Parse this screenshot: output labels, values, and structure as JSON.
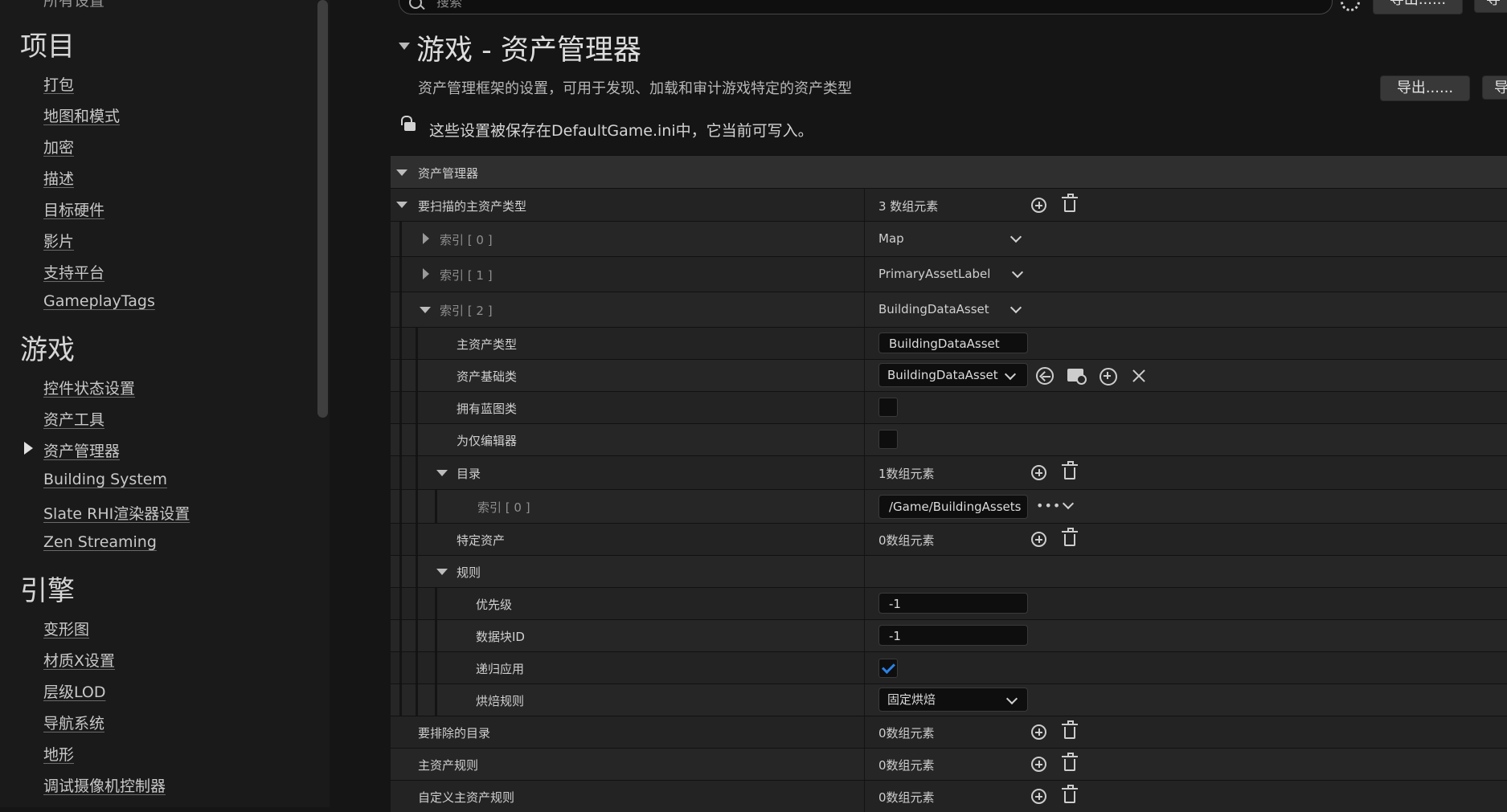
{
  "sidebar": {
    "cut_item": "所有设置",
    "sections": [
      {
        "title": "项目",
        "items": [
          "打包",
          "地图和模式",
          "加密",
          "描述",
          "目标硬件",
          "影片",
          "支持平台",
          "GameplayTags"
        ]
      },
      {
        "title": "游戏",
        "items": [
          "控件状态设置",
          "资产工具",
          "资产管理器",
          "Building System",
          "Slate RHI渲染器设置",
          "Zen Streaming"
        ]
      },
      {
        "title": "引擎",
        "items": [
          "变形图",
          "材质X设置",
          "层级LOD",
          "导航系统",
          "地形",
          "调试摄像机控制器"
        ]
      }
    ],
    "active_item": "资产管理器"
  },
  "toolbar": {
    "search_placeholder": "搜索",
    "export_top_label": "导出......",
    "export_label": "导出......",
    "import_partial_label": "导"
  },
  "header": {
    "title": "游戏 - 资产管理器",
    "description": "资产管理框架的设置，可用于发现、加载和审计游戏特定的资产类型",
    "save_note": "这些设置被保存在DefaultGame.ini中，它当前可写入。"
  },
  "grid": {
    "category": "资产管理器",
    "primary_types": {
      "label": "要扫描的主资产类型",
      "value": "3 数组元素"
    },
    "index0": {
      "label": "索引 [ 0 ]",
      "value": "Map"
    },
    "index1": {
      "label": "索引 [ 1 ]",
      "value": "PrimaryAssetLabel"
    },
    "index2": {
      "label": "索引 [ 2 ]",
      "value": "BuildingDataAsset"
    },
    "primary_asset_type": {
      "label": "主资产类型",
      "value": "BuildingDataAsset"
    },
    "asset_base_class": {
      "label": "资产基础类",
      "value": "BuildingDataAsset"
    },
    "has_blueprint": {
      "label": "拥有蓝图类",
      "checked": false
    },
    "editor_only": {
      "label": "为仅编辑器",
      "checked": false
    },
    "directories": {
      "label": "目录",
      "value": "1数组元素"
    },
    "dir_index0": {
      "label": "索引 [ 0 ]",
      "value": "/Game/BuildingAssets"
    },
    "specific_assets": {
      "label": "特定资产",
      "value": "0数组元素"
    },
    "rules": {
      "label": "规则"
    },
    "priority": {
      "label": "优先级",
      "value": "-1"
    },
    "chunk_id": {
      "label": "数据块ID",
      "value": "-1"
    },
    "apply_recursively": {
      "label": "递归应用",
      "checked": true
    },
    "cook_rule": {
      "label": "烘焙规则",
      "value": "固定烘焙"
    },
    "excluded_dirs": {
      "label": "要排除的目录",
      "value": "0数组元素"
    },
    "primary_asset_rules": {
      "label": "主资产规则",
      "value": "0数组元素"
    },
    "custom_primary_asset_rules": {
      "label": "自定义主资产规则",
      "value": "0数组元素"
    }
  },
  "colors": {
    "accent_check": "#2b82e6",
    "background": "#151515",
    "category_row": "#2f2f2f"
  }
}
